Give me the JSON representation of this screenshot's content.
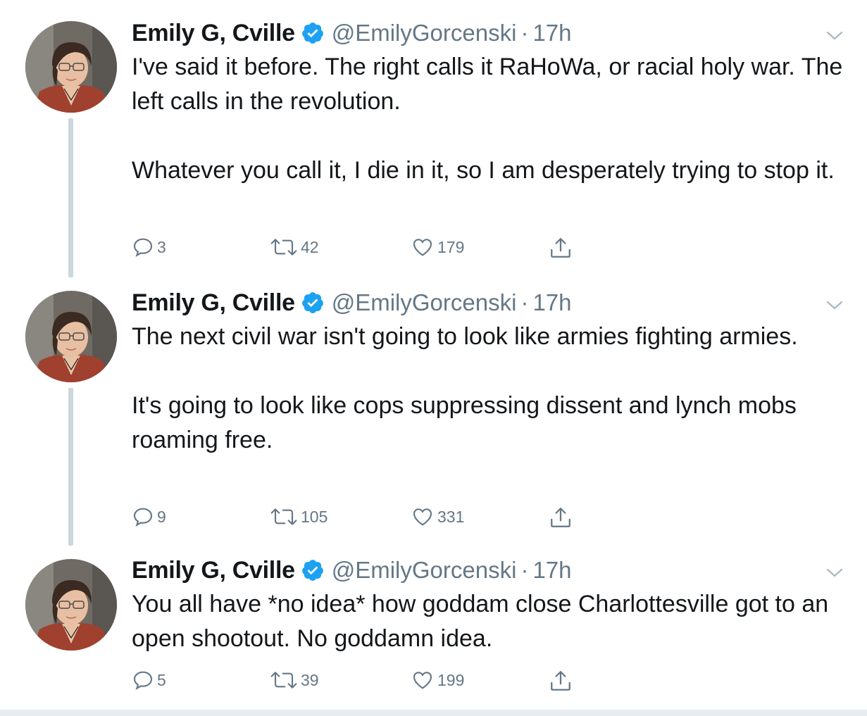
{
  "author": {
    "name": "Emily G, Cville",
    "handle": "@EmilyGorcenski"
  },
  "tweets": [
    {
      "time": "17h",
      "paragraphs": [
        "I've said it before. The right calls it RaHoWa, or racial holy war. The left calls in the revolution.",
        "Whatever you call it, I die in it, so I am desperately trying to stop it."
      ],
      "replies": "3",
      "retweets": "42",
      "likes": "179"
    },
    {
      "time": "17h",
      "paragraphs": [
        "The next civil war isn't going to look like armies fighting armies.",
        "It's going to look like cops suppressing dissent and lynch mobs roaming free."
      ],
      "replies": "9",
      "retweets": "105",
      "likes": "331"
    },
    {
      "time": "17h",
      "paragraphs": [
        "You all have *no idea* how goddam  close Charlottesville got to an open shootout. No goddamn idea."
      ],
      "replies": "5",
      "retweets": "39",
      "likes": "199"
    }
  ],
  "separator": "·",
  "icons": {
    "verified": "verified-badge-icon",
    "menu": "chevron-down-icon",
    "reply": "reply-icon",
    "retweet": "retweet-icon",
    "like": "heart-icon",
    "share": "share-icon"
  },
  "colors": {
    "text": "#14171a",
    "secondary": "#657786",
    "verified": "#1da1f2",
    "thread_line": "#ccd6dd"
  }
}
